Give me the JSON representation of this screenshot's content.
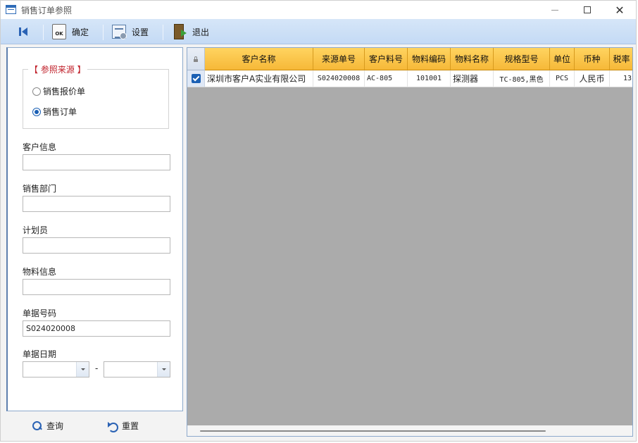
{
  "window": {
    "title": "销售订单参照"
  },
  "toolbar": {
    "ok_label": "确定",
    "ok_icon_text": "OK",
    "settings_label": "设置",
    "exit_label": "退出"
  },
  "filter": {
    "source_group_title": "【 参照来源 】",
    "radio_quote": "销售报价单",
    "radio_order": "销售订单",
    "selected_source": "销售订单",
    "customer_label": "客户信息",
    "customer_value": "",
    "department_label": "销售部门",
    "department_value": "",
    "planner_label": "计划员",
    "planner_value": "",
    "material_label": "物料信息",
    "material_value": "",
    "docno_label": "单据号码",
    "docno_value": "S024020008",
    "date_label": "单据日期",
    "date_from": "",
    "date_to": "",
    "date_separator": "-",
    "query_label": "查询",
    "reset_label": "重置"
  },
  "grid": {
    "columns": [
      "客户名称",
      "来源单号",
      "客户料号",
      "物料编码",
      "物料名称",
      "规格型号",
      "单位",
      "币种",
      "税率"
    ],
    "rows": [
      {
        "checked": true,
        "customer_name": "深圳市客户A实业有限公司",
        "source_no": "S024020008",
        "customer_part_no": "AC-805",
        "material_code": "101001",
        "material_name": "探测器",
        "spec": "TC-805,黑色",
        "unit": "PCS",
        "currency": "人民币",
        "tax_rate": "13"
      }
    ]
  }
}
